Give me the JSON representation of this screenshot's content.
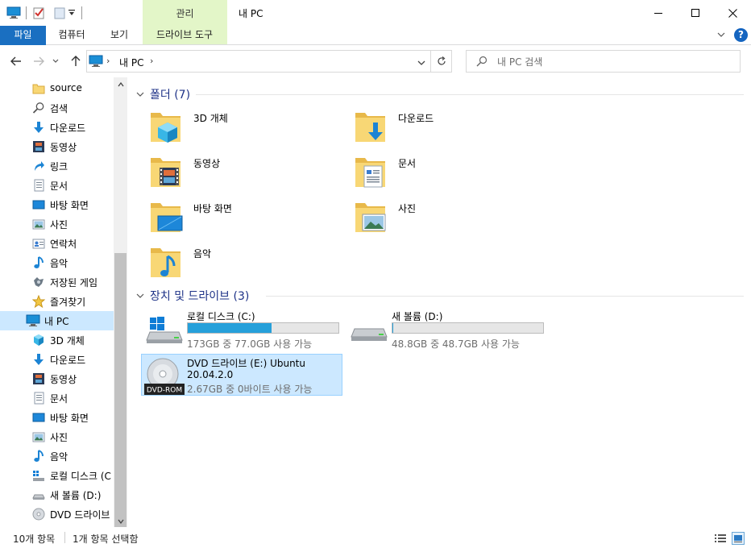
{
  "titlebar": {
    "manage_tab": "관리",
    "window_title": "내 PC"
  },
  "ribbon": {
    "tabs": [
      {
        "label": "파일"
      },
      {
        "label": "컴퓨터"
      },
      {
        "label": "보기"
      },
      {
        "label": "드라이브 도구"
      }
    ],
    "help_label": "?"
  },
  "address": {
    "sep": "›",
    "path": "내 PC",
    "search_placeholder": "내 PC 검색"
  },
  "nav": {
    "items": [
      {
        "label": "source",
        "icon": "folder-icon"
      },
      {
        "label": "검색",
        "icon": "search-icon"
      },
      {
        "label": "다운로드",
        "icon": "download-icon"
      },
      {
        "label": "동영상",
        "icon": "video-icon"
      },
      {
        "label": "링크",
        "icon": "link-icon"
      },
      {
        "label": "문서",
        "icon": "document-icon"
      },
      {
        "label": "바탕 화면",
        "icon": "desktop-icon"
      },
      {
        "label": "사진",
        "icon": "picture-icon"
      },
      {
        "label": "연락처",
        "icon": "contacts-icon"
      },
      {
        "label": "음악",
        "icon": "music-icon"
      },
      {
        "label": "저장된 게임",
        "icon": "saved-games-icon"
      },
      {
        "label": "즐겨찾기",
        "icon": "favorites-icon"
      },
      {
        "label": "내 PC",
        "icon": "pc-icon"
      },
      {
        "label": "3D 개체",
        "icon": "3d-objects-icon"
      },
      {
        "label": "다운로드",
        "icon": "download-icon"
      },
      {
        "label": "동영상",
        "icon": "video-icon"
      },
      {
        "label": "문서",
        "icon": "document-icon"
      },
      {
        "label": "바탕 화면",
        "icon": "desktop-icon"
      },
      {
        "label": "사진",
        "icon": "picture-icon"
      },
      {
        "label": "음악",
        "icon": "music-icon"
      },
      {
        "label": "로컬 디스크 (C",
        "icon": "local-disk-icon"
      },
      {
        "label": "새 볼륨 (D:)",
        "icon": "drive-icon"
      },
      {
        "label": "DVD 드라이브",
        "icon": "dvd-icon"
      }
    ]
  },
  "content": {
    "folders_header": "폴더 (7)",
    "folders": [
      {
        "label": "3D 개체"
      },
      {
        "label": "다운로드"
      },
      {
        "label": "동영상"
      },
      {
        "label": "문서"
      },
      {
        "label": "바탕 화면"
      },
      {
        "label": "사진"
      },
      {
        "label": "음악"
      }
    ],
    "devices_header": "장치 및 드라이브 (3)",
    "drives": [
      {
        "name": "로컬 디스크 (C:)",
        "size": "173GB 중 77.0GB 사용 가능",
        "used_fraction": 0.555
      },
      {
        "name": "새 볼륨 (D:)",
        "size": "48.8GB 중 48.7GB 사용 가능",
        "used_fraction": 0.002
      }
    ],
    "dvd": {
      "name_line1": "DVD 드라이브 (E:) Ubuntu",
      "name_line2": "20.04.2.0",
      "size": "2.67GB 중 0바이트 사용 가능",
      "badge": "DVD-ROM"
    }
  },
  "status": {
    "count": "10개 항목",
    "selected": "1개 항목 선택함"
  },
  "colors": {
    "accent": "#1a6fc1",
    "selection": "#cce8ff",
    "manage_tab_bg": "#e3f6c8",
    "group_title": "#1e3287",
    "drive_fill": "#26a0da"
  }
}
